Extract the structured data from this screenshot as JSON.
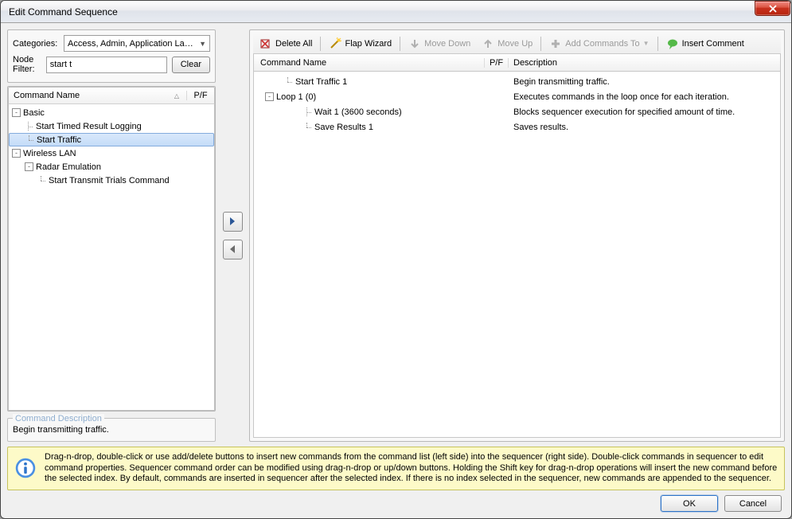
{
  "window": {
    "title": "Edit Command Sequence"
  },
  "left": {
    "categories_label": "Categories:",
    "categories_value": "Access, Admin, Application La…",
    "filter_label": "Node Filter:",
    "filter_value": "start t",
    "clear_label": "Clear",
    "col_command": "Command Name",
    "col_pf": "P/F",
    "desc_head": "Command Description",
    "desc_body": "Begin transmitting traffic."
  },
  "tree": [
    {
      "level": 0,
      "exp": "-",
      "label": "Basic"
    },
    {
      "level": 1,
      "leaf": true,
      "label": "Start Timed Result Logging"
    },
    {
      "level": 1,
      "leaf": true,
      "last": true,
      "label": "Start Traffic",
      "selected": true
    },
    {
      "level": 0,
      "exp": "-",
      "label": "Wireless LAN"
    },
    {
      "level": 1,
      "exp": "-",
      "label": "Radar Emulation"
    },
    {
      "level": 2,
      "leaf": true,
      "last": true,
      "label": "Start Transmit Trials Command"
    }
  ],
  "toolbar": {
    "delete_all": "Delete All",
    "flap_wizard": "Flap Wizard",
    "move_down": "Move Down",
    "move_up": "Move Up",
    "add_commands_to": "Add Commands To",
    "insert_comment": "Insert Comment"
  },
  "right_cols": {
    "c1": "Command Name",
    "c2": "P/F",
    "c3": "Description"
  },
  "sequence": [
    {
      "indent": 1,
      "conn": "end",
      "label": "Start Traffic 1",
      "desc": "Begin transmitting traffic."
    },
    {
      "indent": 0,
      "exp": "-",
      "label": "Loop 1 (0)",
      "desc": "Executes commands in the loop once for each iteration."
    },
    {
      "indent": 2,
      "conn": "mid",
      "label": "Wait 1 (3600 seconds)",
      "desc": "Blocks sequencer execution for specified amount of time."
    },
    {
      "indent": 2,
      "conn": "end",
      "label": "Save Results 1",
      "desc": "Saves results."
    }
  ],
  "info": "Drag-n-drop, double-click or use add/delete buttons to insert new commands from the command list (left side) into the sequencer (right side).  Double-click commands in sequencer to edit command properties.  Sequencer command order can be modified using drag-n-drop or up/down buttons.  Holding the Shift key for drag-n-drop operations will insert the new command before the selected index.  By default, commands are inserted in sequencer after the selected index.  If there is no index selected in the sequencer, new commands are appended to the sequencer.",
  "footer": {
    "ok": "OK",
    "cancel": "Cancel"
  }
}
